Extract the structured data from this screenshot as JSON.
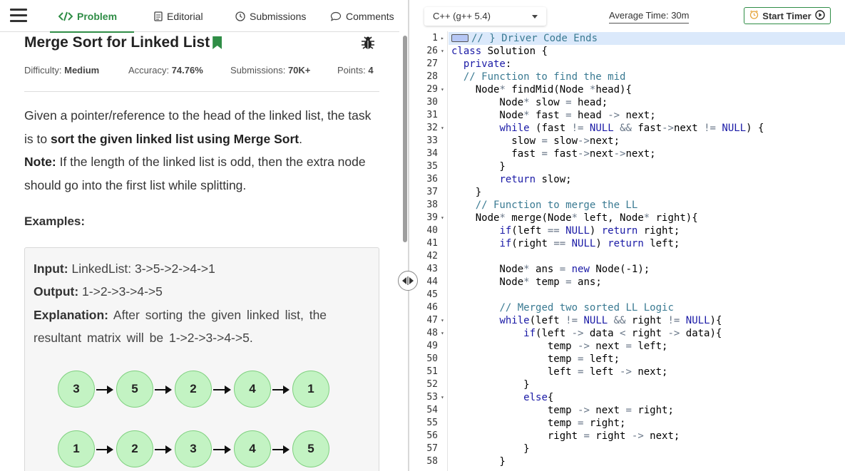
{
  "tabs": {
    "problem": "Problem",
    "editorial": "Editorial",
    "submissions": "Submissions",
    "comments": "Comments"
  },
  "problem": {
    "title": "Merge Sort for Linked List",
    "meta": {
      "difficulty_label": "Difficulty:",
      "difficulty": "Medium",
      "accuracy_label": "Accuracy:",
      "accuracy": "74.76%",
      "submissions_label": "Submissions:",
      "submissions": "70K+",
      "points_label": "Points:",
      "points": "4"
    },
    "desc_p1_a": "Given a pointer/reference to the head of the linked list, the task is to ",
    "desc_p1_b": "sort the given linked list using Merge Sort",
    "desc_p1_c": ".",
    "note_label": "Note:",
    "note_text": " If the length of the linked list is odd, then the extra node should go into the first list while splitting.",
    "examples_heading": "Examples:",
    "example": {
      "input_label": "Input:",
      "input": " LinkedList: 3->5->2->4->1",
      "output_label": "Output:",
      "output": " 1->2->3->4->5",
      "explanation_label": "Explanation:",
      "explanation": " After sorting the given linked list, the resultant matrix will be 1->2->3->4->5.",
      "list_before": [
        "3",
        "5",
        "2",
        "4",
        "1"
      ],
      "list_after": [
        "1",
        "2",
        "3",
        "4",
        "5"
      ]
    }
  },
  "editor": {
    "language": "C++ (g++ 5.4)",
    "average_time": "Average Time: 30m",
    "start_timer": "Start Timer",
    "line_numbers": [
      "1",
      "26",
      "27",
      "28",
      "29",
      "30",
      "31",
      "32",
      "33",
      "34",
      "35",
      "36",
      "37",
      "38",
      "39",
      "40",
      "41",
      "42",
      "43",
      "44",
      "45",
      "46",
      "47",
      "48",
      "49",
      "50",
      "51",
      "52",
      "53",
      "54",
      "55",
      "56",
      "57",
      "58"
    ],
    "fold_lines": [
      "26",
      "29",
      "32",
      "39",
      "47",
      "48",
      "53"
    ],
    "code_lines": [
      "// } Driver Code Ends",
      "class Solution {",
      "  private:",
      "  // Function to find the mid",
      "    Node* findMid(Node *head){",
      "        Node* slow = head;",
      "        Node* fast = head -> next;",
      "        while (fast != NULL && fast->next != NULL) {",
      "          slow = slow->next;",
      "          fast = fast->next->next;",
      "        }",
      "        return slow;",
      "    }",
      "    // Function to merge the LL",
      "    Node* merge(Node* left, Node* right){",
      "        if(left == NULL) return right;",
      "        if(right == NULL) return left;",
      "",
      "        Node* ans = new Node(-1);",
      "        Node* temp = ans;",
      "",
      "        // Merged two sorted LL Logic",
      "        while(left != NULL && right != NULL){",
      "            if(left -> data < right -> data){",
      "                temp -> next = left;",
      "                temp = left;",
      "                left = left -> next;",
      "            }",
      "            else{",
      "                temp -> next = right;",
      "                temp = right;",
      "                right = right -> next;",
      "            }",
      "        }"
    ]
  }
}
